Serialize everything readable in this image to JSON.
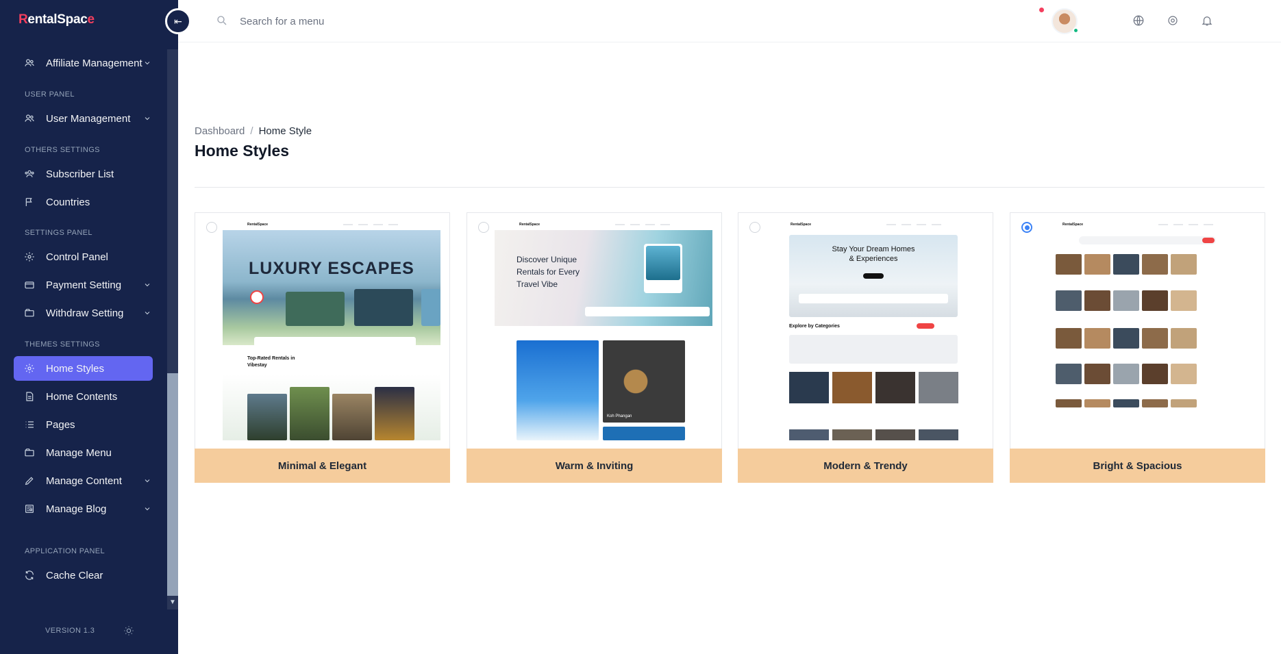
{
  "app": {
    "logo_text": "RentalSpace",
    "collapse_label": "⇤"
  },
  "sidebar": {
    "items": [
      {
        "label": "Affiliate Management",
        "has_children": true
      },
      {
        "section": "USER PANEL"
      },
      {
        "label": "User Management",
        "has_children": true
      },
      {
        "section": "OTHERS SETTINGS"
      },
      {
        "label": "Subscriber List"
      },
      {
        "label": "Countries"
      },
      {
        "section": "SETTINGS PANEL"
      },
      {
        "label": "Control Panel"
      },
      {
        "label": "Payment Setting",
        "has_children": true
      },
      {
        "label": "Withdraw Setting",
        "has_children": true
      },
      {
        "section": "THEMES SETTINGS"
      },
      {
        "label": "Home Styles",
        "active": true
      },
      {
        "label": "Home Contents"
      },
      {
        "label": "Pages"
      },
      {
        "label": "Manage Menu"
      },
      {
        "label": "Manage Content",
        "has_children": true
      },
      {
        "label": "Manage Blog",
        "has_children": true
      },
      {
        "section": "APPLICATION PANEL"
      },
      {
        "label": "Cache Clear"
      }
    ],
    "version": "VERSION 1.3"
  },
  "header": {
    "search_placeholder": "Search for a menu"
  },
  "main": {
    "breadcrumb": {
      "root": "Dashboard",
      "separator": "/",
      "current": "Home Style"
    },
    "title": "Home Styles",
    "styles": [
      {
        "label": "Minimal & Elegant",
        "selected": false,
        "hero": "LUXURY ESCAPES",
        "section": "Top-Rated Rentals in Vibestay"
      },
      {
        "label": "Warm & Inviting",
        "selected": false,
        "hero": "Discover Unique Rentals for Every Travel Vibe",
        "section": "Koh Phangan"
      },
      {
        "label": "Modern & Trendy",
        "selected": false,
        "hero": "Stay Your Dream Homes & Experiences",
        "section": "Explore by Categories"
      },
      {
        "label": "Bright & Spacious",
        "selected": true,
        "hero": "",
        "section": ""
      }
    ]
  },
  "colors": {
    "sidebar_bg": "#16234a",
    "accent": "#6366f1",
    "brand": "#f43f5e",
    "card_label_bg": "#f5cc9c",
    "selected": "#3b82f6"
  }
}
